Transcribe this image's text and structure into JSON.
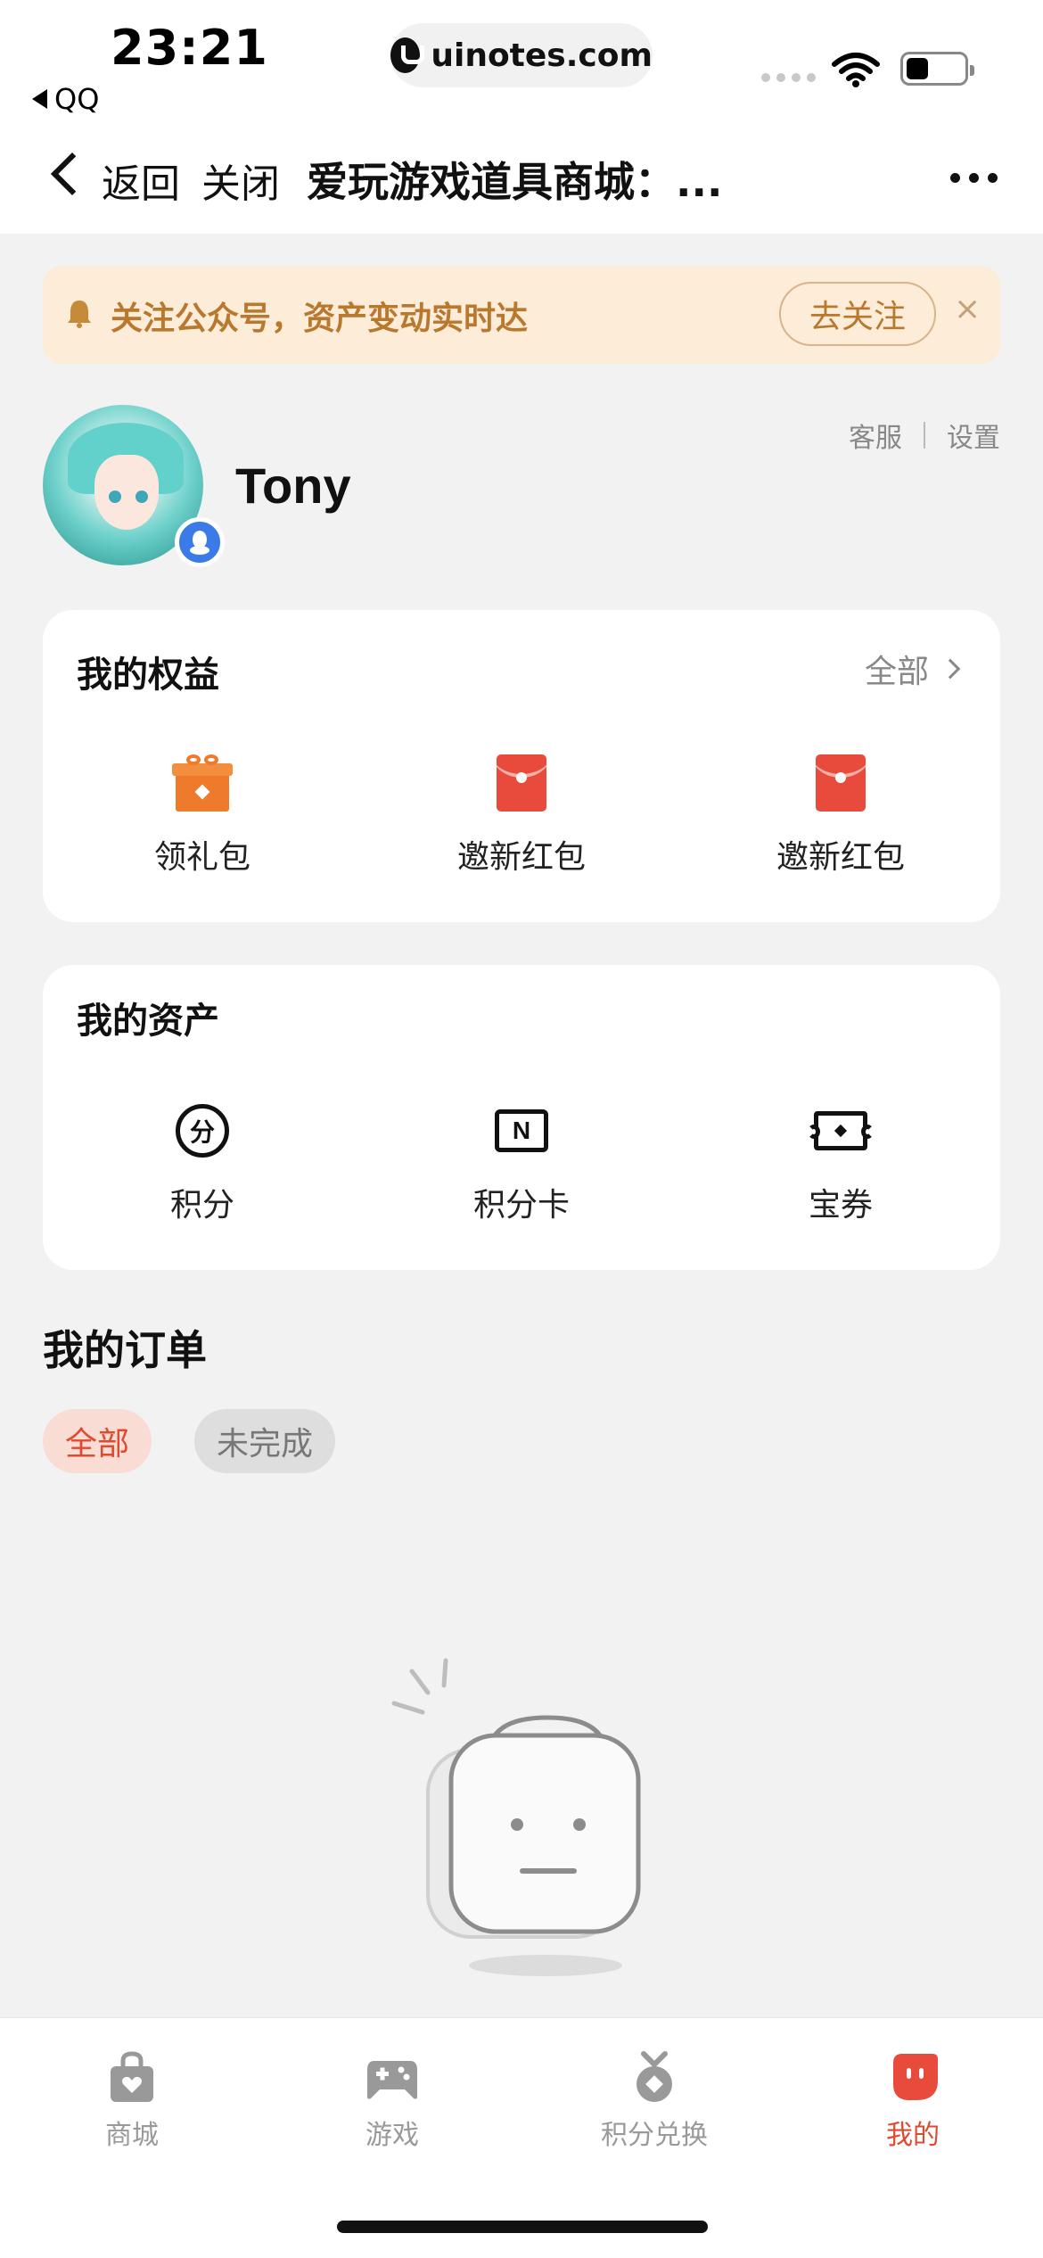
{
  "status": {
    "time": "23:21",
    "back_app": "QQ",
    "url": "uinotes.com"
  },
  "nav": {
    "back": "返回",
    "close": "关闭",
    "title": "爱玩游戏道具商城：..."
  },
  "notice": {
    "text": "关注公众号，资产变动实时达",
    "follow": "去关注",
    "close": "×"
  },
  "profile": {
    "name": "Tony",
    "links": [
      "客服",
      "设置"
    ]
  },
  "benefits": {
    "title": "我的权益",
    "all": "全部",
    "items": [
      {
        "label": "领礼包",
        "icon": "gift-icon"
      },
      {
        "label": "邀新红包",
        "icon": "red-envelope-icon"
      },
      {
        "label": "邀新红包",
        "icon": "red-envelope-icon"
      }
    ]
  },
  "assets": {
    "title": "我的资产",
    "items": [
      {
        "label": "积分",
        "icon": "points-coin-icon",
        "glyph": "分"
      },
      {
        "label": "积分卡",
        "icon": "points-card-icon",
        "glyph": "N"
      },
      {
        "label": "宝券",
        "icon": "coupon-icon"
      }
    ]
  },
  "orders": {
    "title": "我的订单",
    "filters": [
      "全部",
      "未完成"
    ],
    "active_filter": "全部"
  },
  "tabbar": {
    "items": [
      {
        "label": "商城",
        "icon": "shopping-bag-icon"
      },
      {
        "label": "游戏",
        "icon": "gamepad-icon"
      },
      {
        "label": "积分兑换",
        "icon": "medal-icon"
      },
      {
        "label": "我的",
        "icon": "profile-face-icon"
      }
    ],
    "active": "我的"
  },
  "colors": {
    "accent": "#e04a2f",
    "notice_bg": "#fcecd8",
    "notice_text": "#b8782e",
    "page_bg": "#f2f2f2"
  }
}
